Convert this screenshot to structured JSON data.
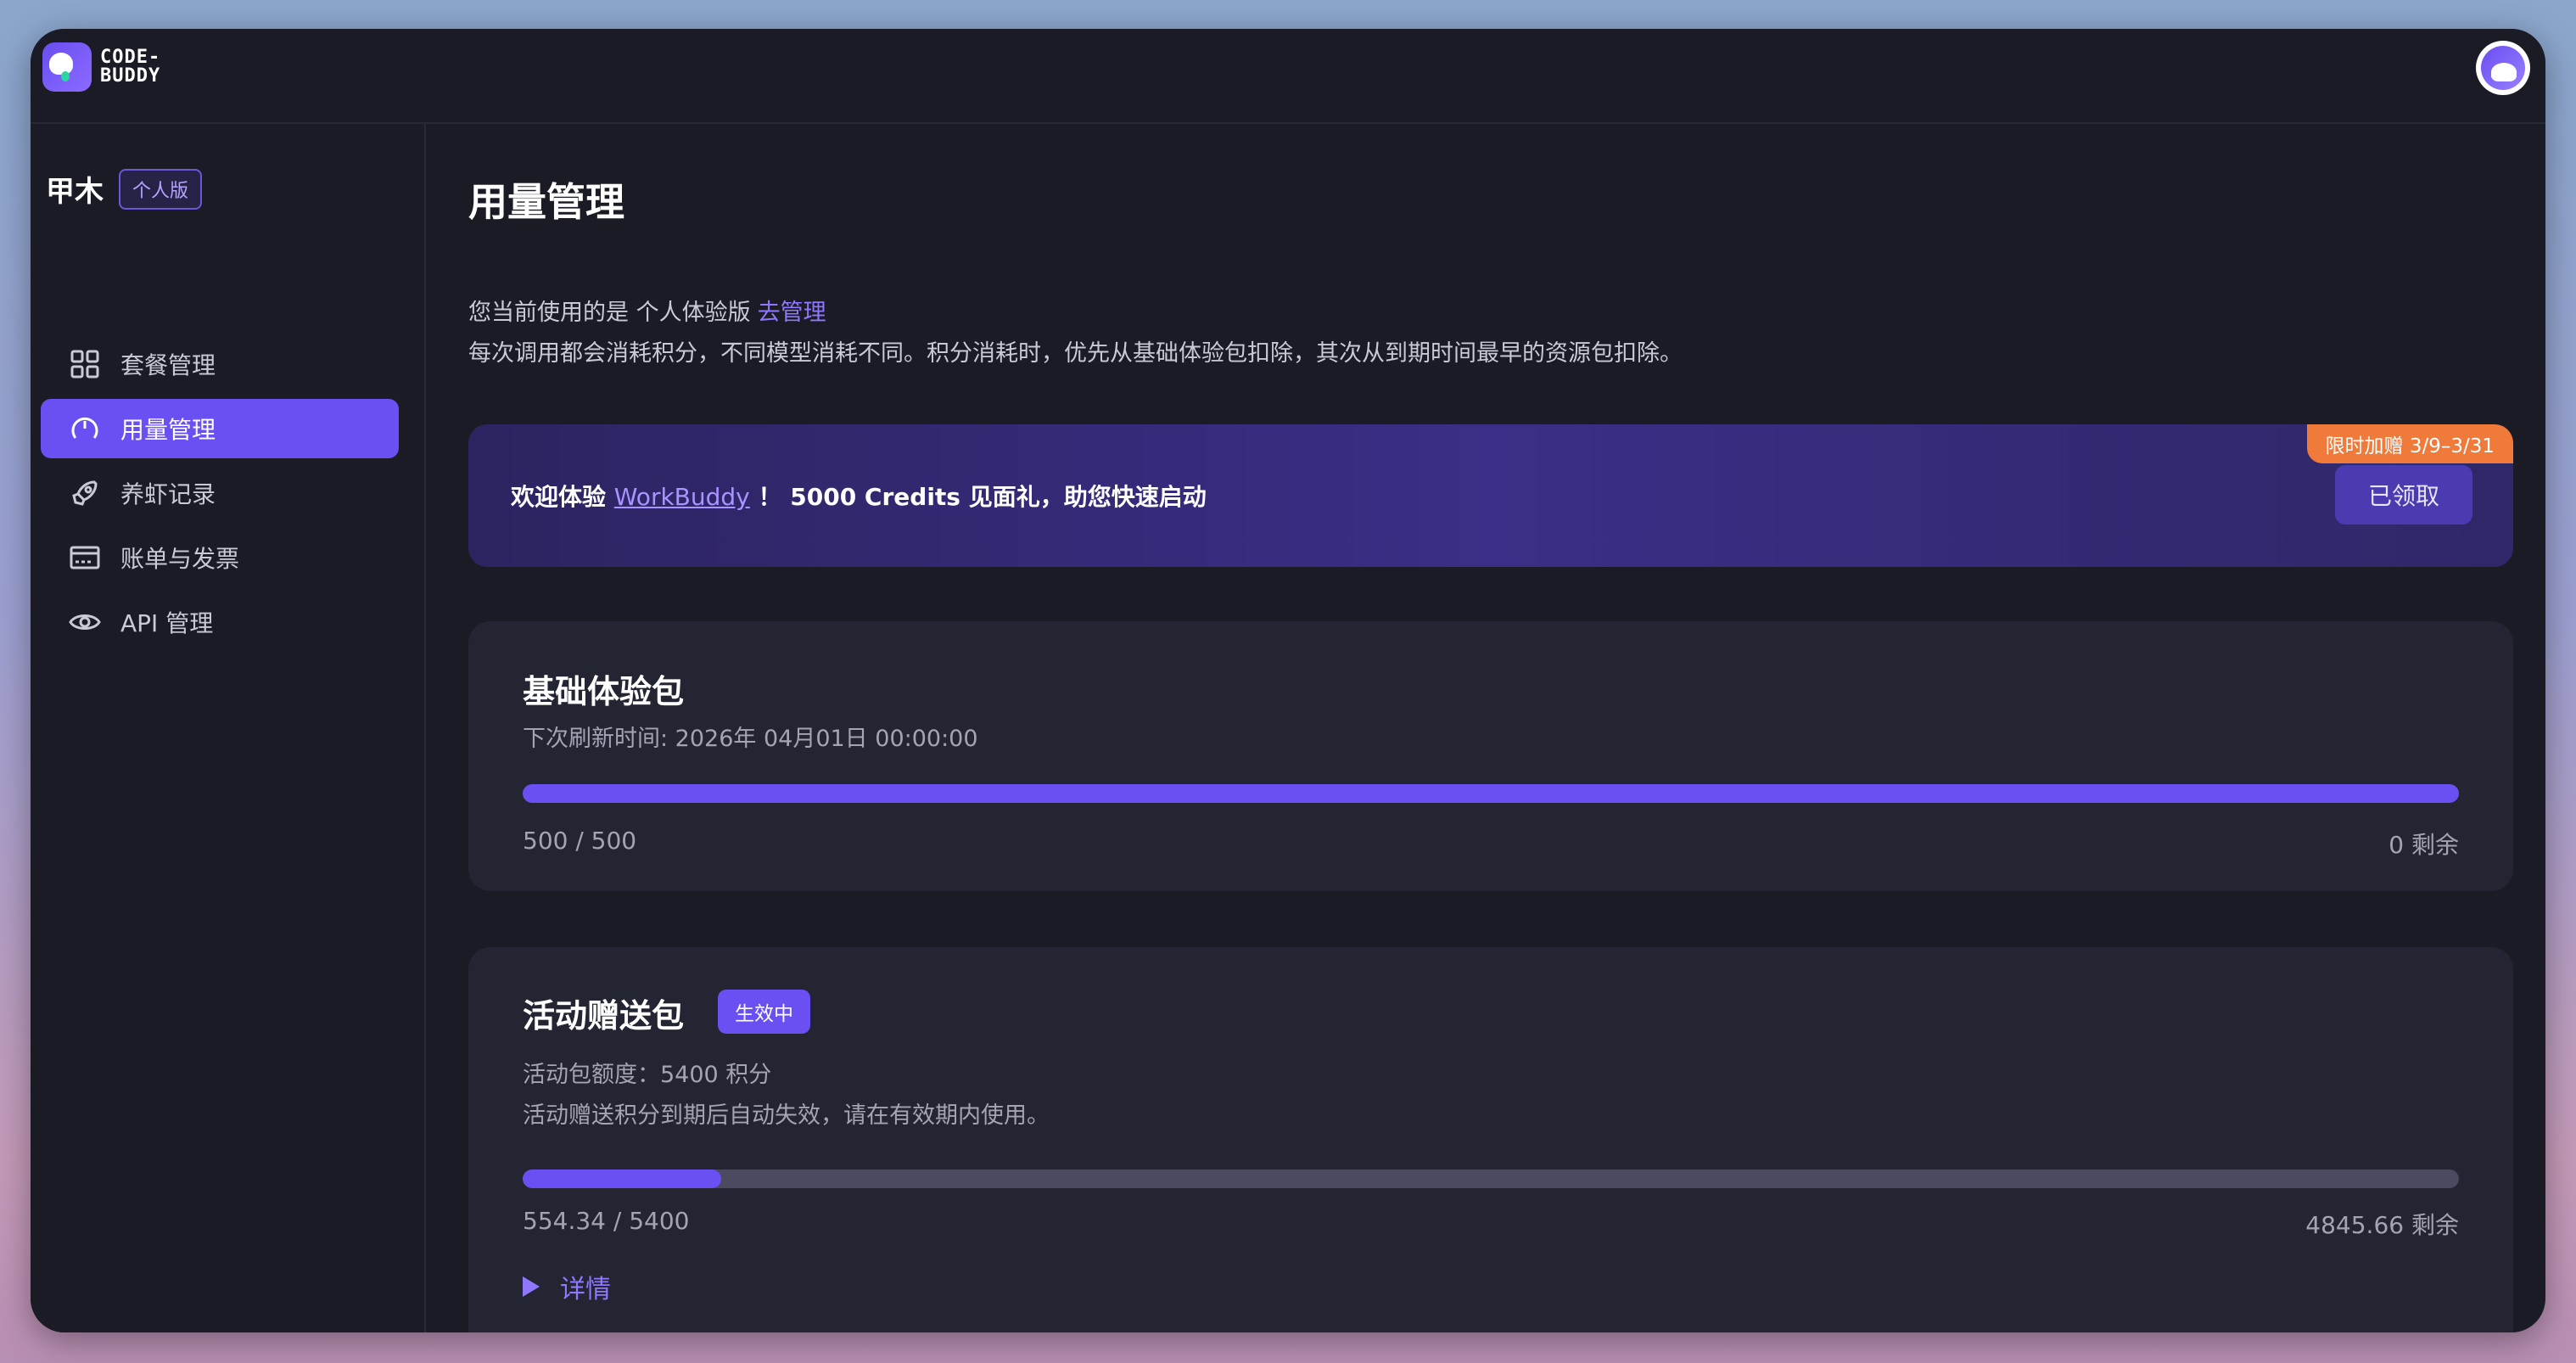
{
  "app": {
    "logo_text_line1": "CODE-",
    "logo_text_line2": "BUDDY"
  },
  "sidebar": {
    "user_name": "甲木",
    "plan_badge": "个人版",
    "items": [
      {
        "label": "套餐管理",
        "icon": "grid-icon",
        "active": false
      },
      {
        "label": "用量管理",
        "icon": "gauge-icon",
        "active": true
      },
      {
        "label": "养虾记录",
        "icon": "rocket-icon",
        "active": false
      },
      {
        "label": "账单与发票",
        "icon": "credit-card-icon",
        "active": false
      },
      {
        "label": "API 管理",
        "icon": "eye-icon",
        "active": false
      }
    ]
  },
  "main": {
    "title": "用量管理",
    "current_plan_prefix": "您当前使用的是 个人体验版",
    "manage_link": "去管理",
    "description": "每次调用都会消耗积分，不同模型消耗不同。积分消耗时，优先从基础体验包扣除，其次从到期时间最早的资源包扣除。"
  },
  "promo": {
    "text_prefix": "欢迎体验",
    "link_text": "WorkBuddy",
    "text_suffix": "！ 5000 Credits 见面礼，助您快速启动",
    "tag": "限时加赠 3/9–3/31",
    "button_label": "已领取"
  },
  "basic_pack": {
    "title": "基础体验包",
    "refresh_text": "下次刷新时间: 2026年 04月01日 00:00:00",
    "used_text": "500 / 500",
    "remaining_text": "0 剩余",
    "progress_fraction": 1.0
  },
  "activity_pack": {
    "title": "活动赠送包",
    "status": "生效中",
    "quota_text": "活动包额度：5400 积分",
    "note_text": "活动赠送积分到期后自动失效，请在有效期内使用。",
    "used_text": "554.34 / 5400",
    "remaining_text": "4845.66 剩余",
    "progress_fraction": 0.1027,
    "details_label": "详情"
  },
  "colors": {
    "accent": "#6a4ff2",
    "link": "#8f78ff",
    "promo_tag": "#f07a3a"
  }
}
